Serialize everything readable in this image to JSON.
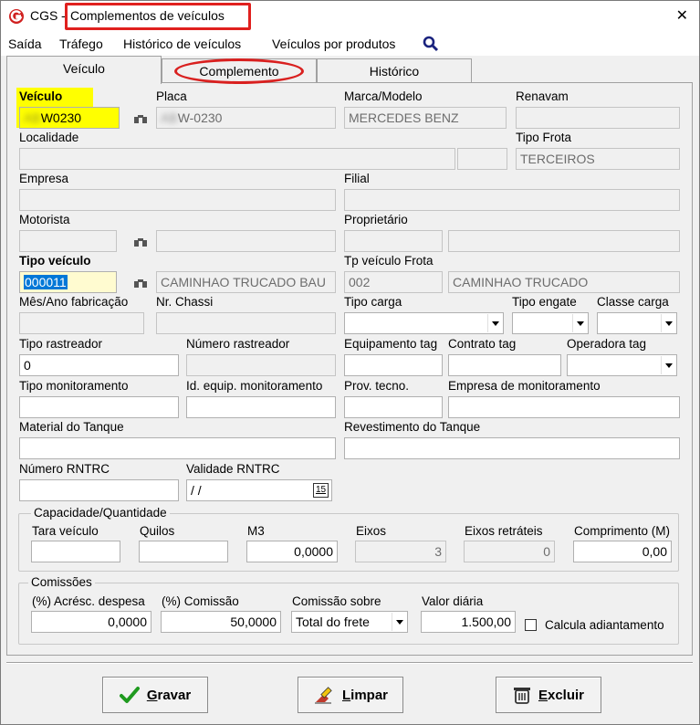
{
  "window": {
    "app_name": "CGS",
    "separator": "-",
    "title": "Complementos de veículos",
    "close": "✕"
  },
  "menu": [
    "Saída",
    "Tráfego",
    "Histórico de veículos",
    "Veículos por produtos"
  ],
  "tabs": [
    "Veículo",
    "Complemento",
    "Histórico"
  ],
  "labels": {
    "veiculo": "Veículo",
    "placa": "Placa",
    "marca_modelo": "Marca/Modelo",
    "renavam": "Renavam",
    "localidade": "Localidade",
    "tipo_frota": "Tipo Frota",
    "empresa": "Empresa",
    "filial": "Filial",
    "motorista": "Motorista",
    "proprietario": "Proprietário",
    "tipo_veiculo": "Tipo veículo",
    "tp_veiculo_frota": "Tp veículo Frota",
    "mes_ano_fabricacao": "Mês/Ano fabricação",
    "nr_chassi": "Nr. Chassi",
    "tipo_carga": "Tipo carga",
    "tipo_engate": "Tipo engate",
    "classe_carga": "Classe carga",
    "tipo_rastreador": "Tipo rastreador",
    "numero_rastreador": "Número rastreador",
    "equipamento_tag": "Equipamento tag",
    "contrato_tag": "Contrato tag",
    "operadora_tag": "Operadora tag",
    "tipo_monitoramento": "Tipo monitoramento",
    "id_equip_monitoramento": "Id. equip. monitoramento",
    "prov_tecno": "Prov. tecno.",
    "empresa_monitoramento": "Empresa de monitoramento",
    "material_tanque": "Material do Tanque",
    "revestimento_tanque": "Revestimento do Tanque",
    "numero_rntrc": "Número RNTRC",
    "validade_rntrc": "Validade RNTRC"
  },
  "values": {
    "veiculo": "W0230",
    "placa": "W-0230",
    "marca_modelo": "MERCEDES BENZ",
    "tipo_frota": "TERCEIROS",
    "tipo_veiculo_codigo": "000011",
    "tipo_veiculo_descricao": "CAMINHAO TRUCADO BAU",
    "tp_veiculo_frota_codigo": "002",
    "tp_veiculo_frota_descricao": "CAMINHAO TRUCADO",
    "tipo_rastreador": "0",
    "validade_rntrc": "/ /",
    "calendar_icon_text": "15"
  },
  "capacidade": {
    "title": "Capacidade/Quantidade",
    "labels": [
      "Tara veículo",
      "Quilos",
      "M3",
      "Eixos",
      "Eixos retráteis",
      "Comprimento (M)"
    ],
    "values": [
      "",
      "",
      "0,0000",
      "3",
      "0",
      "0,00"
    ]
  },
  "comissoes": {
    "title": "Comissões",
    "labels": [
      "(%) Acrésc. despesa",
      "(%) Comissão",
      "Comissão sobre",
      "Valor diária"
    ],
    "acresc_despesa": "0,0000",
    "comissao": "50,0000",
    "comissao_sobre": "Total do frete",
    "valor_diaria": "1.500,00",
    "calcula_adiantamento": "Calcula adiantamento"
  },
  "buttons": {
    "gravar_first": "G",
    "gravar_rest": "ravar",
    "limpar_first": "L",
    "limpar_rest": "impar",
    "excluir_first": "E",
    "excluir_rest": "xcluir"
  },
  "colors": {
    "highlight_red": "#e0201e",
    "label_highlight_yellow": "#ffff00",
    "selected_field_bg": "#fffbd0",
    "selection_blue": "#0078d7"
  }
}
